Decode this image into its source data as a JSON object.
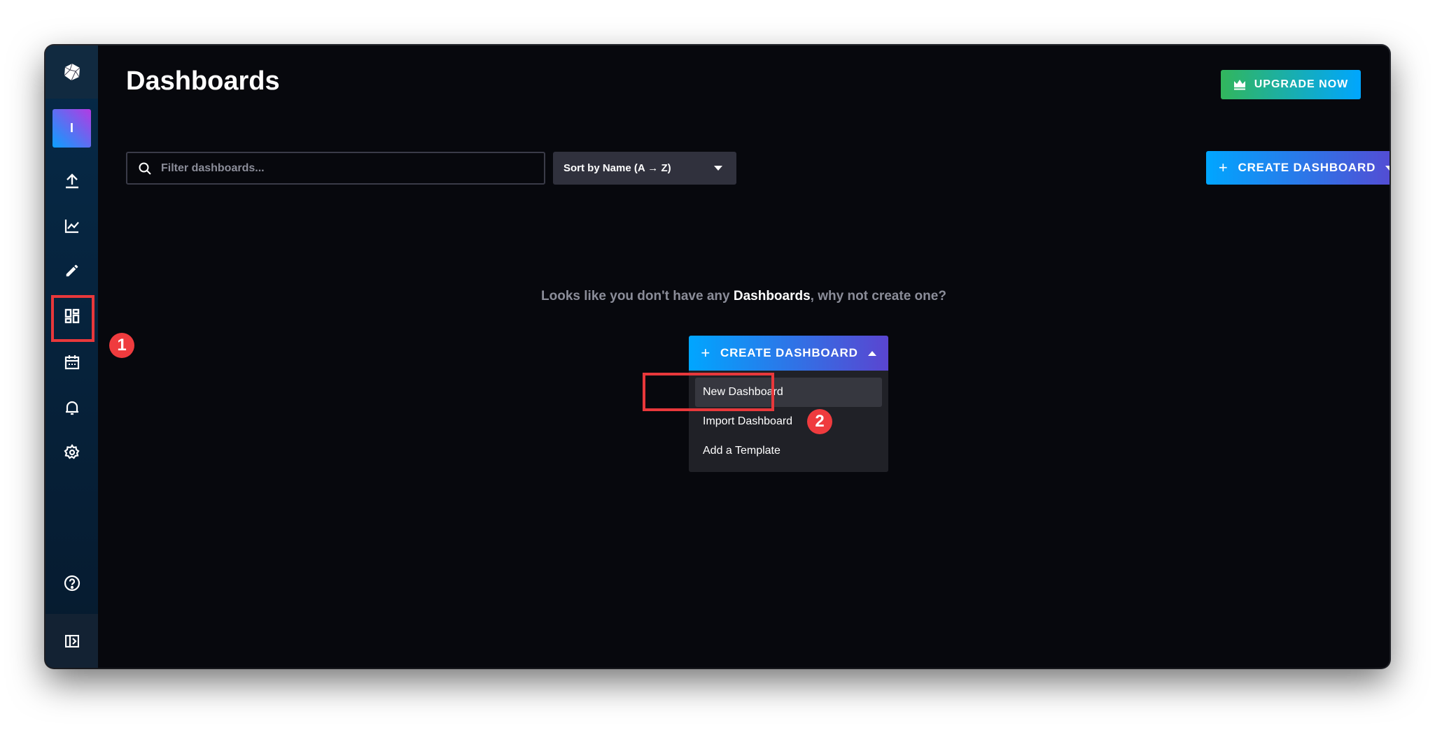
{
  "page": {
    "title": "Dashboards"
  },
  "sidebar": {
    "avatar_initial": "I",
    "items": [
      {
        "icon": "upload-icon"
      },
      {
        "icon": "chart-icon"
      },
      {
        "icon": "pencil-icon"
      },
      {
        "icon": "dashboards-icon",
        "active": true
      },
      {
        "icon": "calendar-icon"
      },
      {
        "icon": "bell-icon"
      },
      {
        "icon": "gear-icon"
      },
      {
        "icon": "help-icon"
      },
      {
        "icon": "expand-sidebar-icon"
      }
    ]
  },
  "header": {
    "upgrade_label": "UPGRADE NOW"
  },
  "toolbar": {
    "search_placeholder": "Filter dashboards...",
    "sort_label": "Sort by Name (A → Z)",
    "create_label": "CREATE DASHBOARD"
  },
  "empty": {
    "prefix": "Looks like you don't have any ",
    "strong": "Dashboards",
    "suffix": ", why not create one?",
    "create_label": "CREATE DASHBOARD"
  },
  "menu": {
    "items": [
      "New Dashboard",
      "Import Dashboard",
      "Add a Template"
    ]
  },
  "annotations": {
    "step1": "1",
    "step2": "2"
  },
  "colors": {
    "accent_start": "#00a6ff",
    "accent_end": "#5a45d0",
    "upgrade_start": "#32b65c",
    "highlight": "#e8383b"
  }
}
